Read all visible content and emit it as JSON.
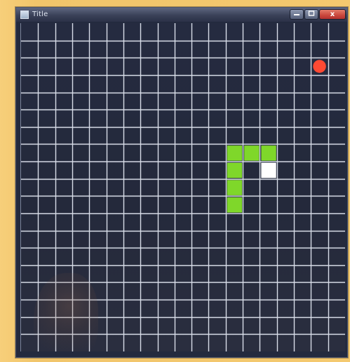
{
  "window": {
    "title": "Title",
    "title_icon": "app-window-icon",
    "controls": {
      "minimize_icon": "minimize-icon",
      "maximize_icon": "maximize-icon",
      "close_icon": "close-icon",
      "close_label": "x"
    }
  },
  "game": {
    "grid": {
      "columns": 19,
      "rows": 19,
      "line_color": "#d8dde8",
      "background_color": "#252b40"
    },
    "snake": {
      "body_color": "#7fd72a",
      "head_color": "#ffffff",
      "segments": [
        {
          "col": 12,
          "row": 7,
          "part": "body"
        },
        {
          "col": 13,
          "row": 7,
          "part": "body"
        },
        {
          "col": 14,
          "row": 7,
          "part": "body"
        },
        {
          "col": 14,
          "row": 8,
          "part": "head"
        },
        {
          "col": 12,
          "row": 8,
          "part": "body"
        },
        {
          "col": 12,
          "row": 9,
          "part": "body"
        },
        {
          "col": 12,
          "row": 10,
          "part": "body"
        }
      ]
    },
    "food": {
      "col": 17,
      "row": 2,
      "color": "#ff4a33",
      "icon": "apple-dot"
    }
  }
}
